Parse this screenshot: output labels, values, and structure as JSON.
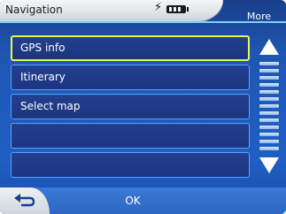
{
  "header": {
    "title": "Navigation",
    "more_label": "More"
  },
  "menu": {
    "items": [
      {
        "label": "GPS info",
        "selected": true
      },
      {
        "label": "Itinerary",
        "selected": false
      },
      {
        "label": "Select map",
        "selected": false
      },
      {
        "label": "",
        "selected": false
      },
      {
        "label": "",
        "selected": false
      }
    ]
  },
  "footer": {
    "ok_label": "OK"
  },
  "icons": {
    "charge": "lightning-icon",
    "battery": "battery-icon",
    "scroll_up": "arrow-up-icon",
    "scroll_down": "arrow-down-icon",
    "back": "back-arrow-icon"
  },
  "colors": {
    "background": "#1f5fc4",
    "item_fill": "#233f8f",
    "item_border": "#5aa3ff",
    "selected_border": "#e7f35a"
  }
}
